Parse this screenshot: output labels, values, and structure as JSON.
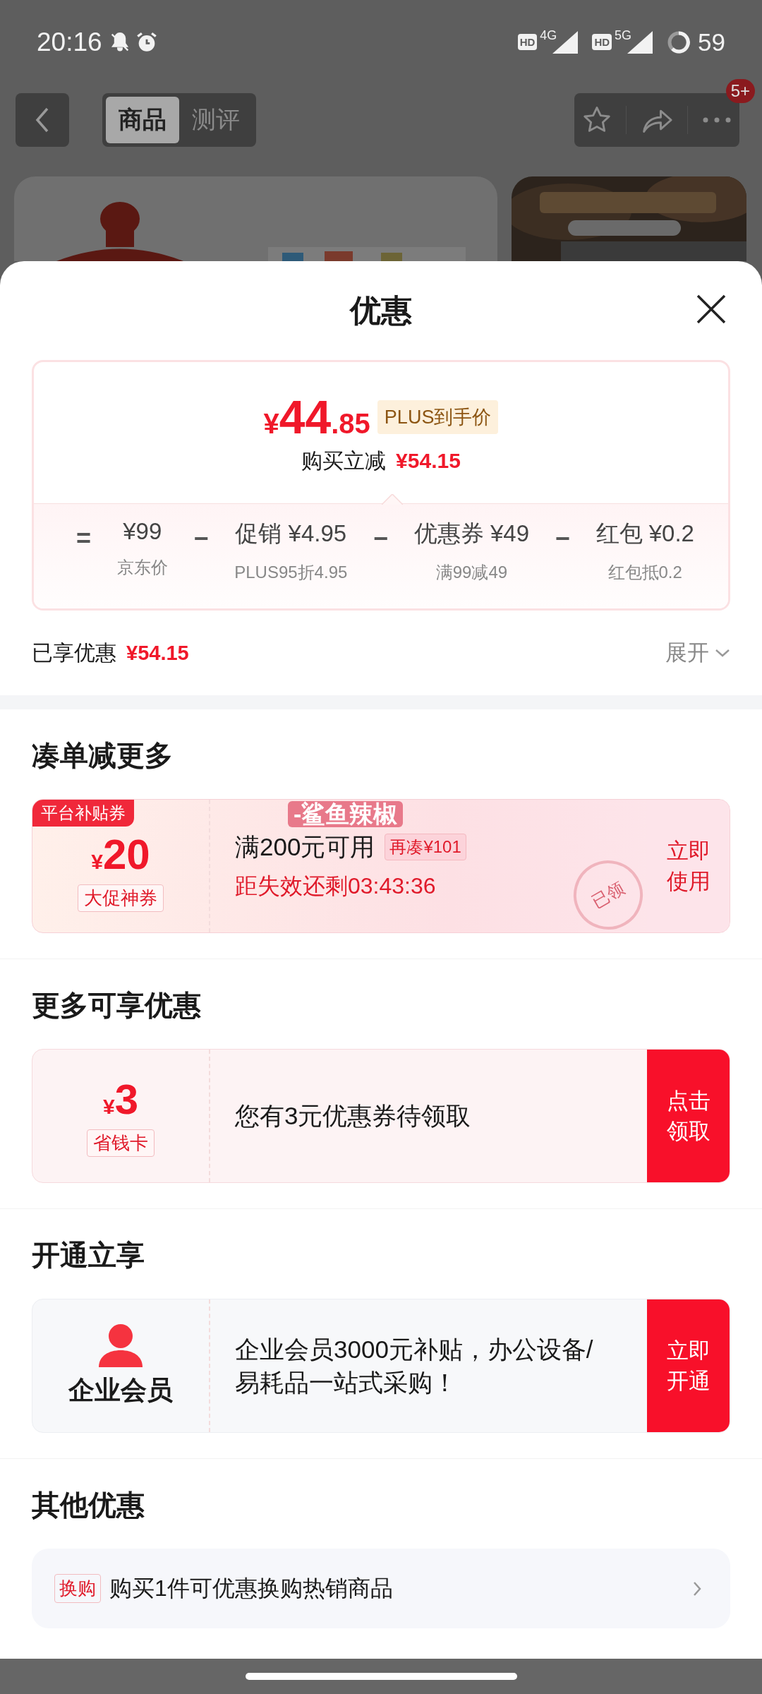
{
  "status_bar": {
    "time": "20:16",
    "hd_1": "HD",
    "network_1": "4G",
    "hd_2": "HD",
    "network_2": "5G",
    "battery": "59"
  },
  "nav": {
    "tabs": [
      {
        "label": "商品",
        "selected": true
      },
      {
        "label": "测评",
        "selected": false
      }
    ],
    "badge": "5+"
  },
  "sheet": {
    "title": "优惠"
  },
  "price_card": {
    "currency": "¥",
    "price_integer": "44",
    "price_decimal": ".85",
    "price_tag": "PLUS到手价",
    "reduction_label": "购买立减",
    "reduction": "¥54.15",
    "breakdown": [
      {
        "operator": "=",
        "amount": "¥99",
        "note": "京东价"
      },
      {
        "operator": "−",
        "label": "促销",
        "amount": "¥4.95",
        "note": "PLUS95折4.95"
      },
      {
        "operator": "−",
        "label": "优惠券",
        "amount": "¥49",
        "note": "满99减49"
      },
      {
        "operator": "−",
        "label": "红包",
        "amount": "¥0.2",
        "note": "红包抵0.2"
      }
    ]
  },
  "saved": {
    "label": "已享优惠",
    "amount": "¥54.15",
    "toggle": "展开"
  },
  "combine_section": {
    "title": "凑单减更多",
    "coupon": {
      "tag": "平台补贴券",
      "currency": "¥",
      "value": "20",
      "badge": "大促神券",
      "banner_text": "-鲨鱼辣椒",
      "condition": "满200元可用",
      "extra": "再凑¥101",
      "countdown": "距失效还剩03:43:36",
      "stamp": "已领",
      "action": "立即使用"
    }
  },
  "more_section": {
    "title": "更多可享优惠",
    "offer": {
      "currency": "¥",
      "value": "3",
      "badge": "省钱卡",
      "text": "您有3元优惠券待领取",
      "action": "点击领取"
    }
  },
  "membership_section": {
    "title": "开通立享",
    "offer": {
      "label": "企业会员",
      "text": " 企业会员3000元补贴，办公设备/易耗品一站式采购！",
      "action": "立即开通"
    }
  },
  "other_section": {
    "title": "其他优惠",
    "row": {
      "tag": "换购",
      "text": "购买1件可优惠换购热销商品"
    }
  }
}
